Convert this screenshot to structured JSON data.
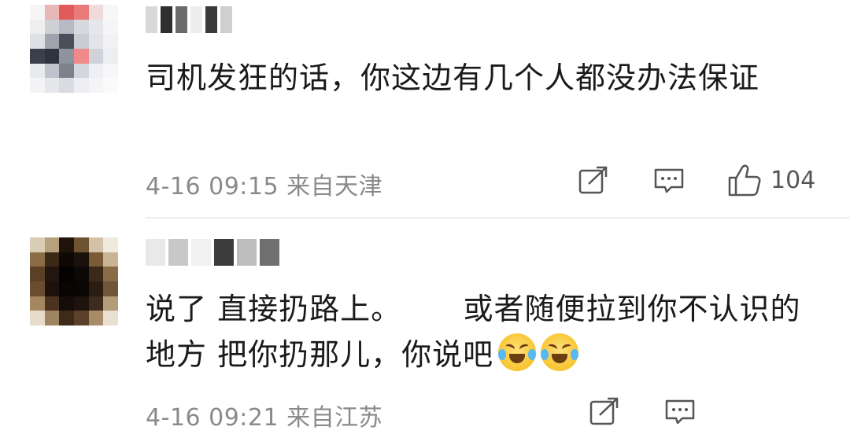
{
  "comments": [
    {
      "text": "司机发狂的话，你这边有几个人都没办法保证",
      "time": "4-16 09:15",
      "location": "来自天津",
      "likes": "104",
      "avatar_colors": [
        "#f5f5f5",
        "#e8b8b8",
        "#e35a5a",
        "#e87a7a",
        "#f1dada",
        "#f7f7f7",
        "#eeeeee",
        "#cfd0d4",
        "#b7bac3",
        "#d6d8dd",
        "#e6e7ea",
        "#f5f5f7",
        "#dfe0e4",
        "#9fa3ae",
        "#4b4f5a",
        "#c9ccd3",
        "#e3e4e8",
        "#f2f2f4",
        "#3b3f4b",
        "#2f3340",
        "#8f939e",
        "#f08a8a",
        "#cfd2d9",
        "#eceef1",
        "#e9eaee",
        "#bfc2ca",
        "#7d818c",
        "#d3d6dc",
        "#eef0f3",
        "#f7f7f9",
        "#f4f4f6",
        "#e6e7eb",
        "#d9dbe0",
        "#eceef1",
        "#f5f5f7",
        "#fafafa"
      ],
      "username_colors": [
        "#d8d8d8",
        "#2f2f2f",
        "#6b6b6b",
        "#ededed",
        "#3a3a3a",
        "#cfcfcf"
      ]
    },
    {
      "text": "说了 直接扔路上。      或者随便拉到你不认识的\n地方 把你扔那儿，你说吧",
      "time": "4-16 09:21",
      "location": "来自江苏",
      "avatar_colors": [
        "#d9cdb6",
        "#b7a07c",
        "#1e140c",
        "#6e5330",
        "#d2c3a8",
        "#efe9de",
        "#8c6c45",
        "#3b2816",
        "#0f0906",
        "#1a110a",
        "#7b5a36",
        "#c9b596",
        "#5a4126",
        "#221610",
        "#050302",
        "#0c0805",
        "#3a2818",
        "#8a6b48",
        "#6a4d2f",
        "#1c120b",
        "#080504",
        "#0a0604",
        "#2b1d12",
        "#6f5638",
        "#a6865f",
        "#4a3420",
        "#140d08",
        "#1d130c",
        "#3e2b1b",
        "#b59c78",
        "#e7dccb",
        "#9f8461",
        "#3d2a19",
        "#5b4129",
        "#a88c68",
        "#e9e0d1"
      ],
      "username_colors": [
        "#e9e9e9",
        "#c8c8c8",
        "#f1f1f1",
        "#3c3c3c",
        "#bdbdbd",
        "#6f6f6f"
      ]
    }
  ],
  "icons": {
    "share": "share-icon",
    "reply": "comment-icon",
    "like": "thumbs-up-icon",
    "emoji": "laugh-cry-emoji"
  }
}
